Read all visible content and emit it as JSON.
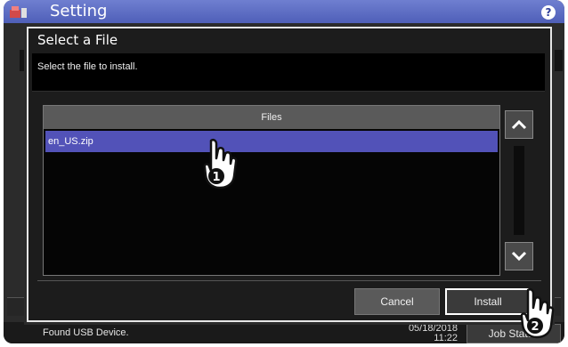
{
  "app": {
    "title": "Setting",
    "help_label": "?"
  },
  "dialog": {
    "title": "Select a File",
    "message": "Select the file to install.",
    "files": {
      "header": "Files",
      "rows": [
        "en_US.zip"
      ]
    },
    "buttons": {
      "cancel": "Cancel",
      "install": "Install"
    }
  },
  "status": {
    "message": "Found USB Device.",
    "date": "05/18/2018",
    "time": "11:22",
    "job_status": "Job Status"
  },
  "callouts": {
    "step1": "1",
    "step2": "2"
  },
  "colors": {
    "title_bar": "#5f6fc4",
    "selected_row": "#5252b8",
    "dialog_bg": "#1c1c1c",
    "header_bg": "#5a5a5a"
  }
}
